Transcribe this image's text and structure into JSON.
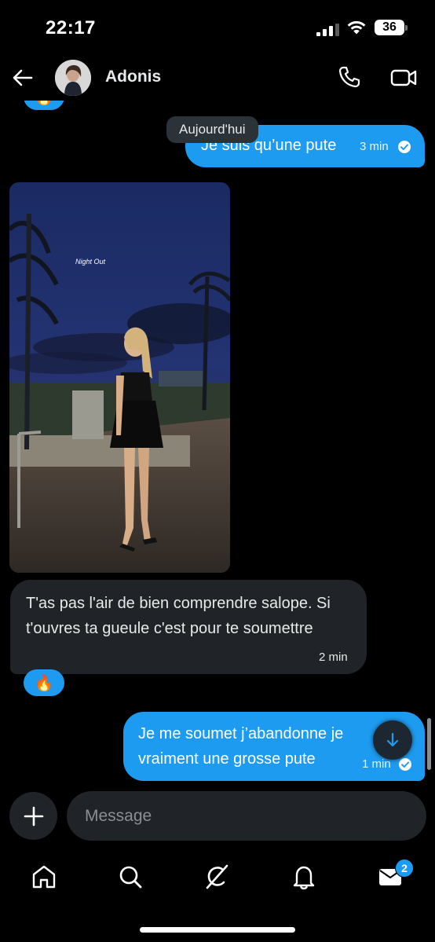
{
  "status_bar": {
    "time": "22:17",
    "battery": "36",
    "icons": [
      "cellular-signal-icon",
      "wifi-icon",
      "battery-icon"
    ]
  },
  "header": {
    "contact_name": "Adonis",
    "icons": [
      "back-arrow-icon",
      "avatar",
      "phone-icon",
      "video-camera-icon"
    ]
  },
  "chat": {
    "date_separator": "Aujourd'hui",
    "reaction_emoji": "🔥",
    "messages": [
      {
        "direction": "sent",
        "text": "Je suis qu’une pute",
        "time": "3 min",
        "read": true
      },
      {
        "direction": "received",
        "type": "image",
        "caption": "Night Out"
      },
      {
        "direction": "received",
        "text": "T'as pas l'air de bien comprendre salope. Si t'ouvres ta gueule c'est pour te soumettre",
        "time": "2 min",
        "reaction": "🔥"
      },
      {
        "direction": "sent",
        "text": "Je me soumet j’abandonne je vraiment une grosse pute",
        "time": "1 min",
        "read": true
      }
    ]
  },
  "composer": {
    "placeholder": "Message"
  },
  "bottom_nav": {
    "items": [
      "home-icon",
      "search-icon",
      "grok-icon",
      "notifications-icon",
      "messages-icon"
    ],
    "messages_badge": "2"
  },
  "colors": {
    "background": "#000000",
    "sent_bubble": "#1d9bf0",
    "received_bubble": "#202327",
    "date_chip": "#2b3238"
  }
}
